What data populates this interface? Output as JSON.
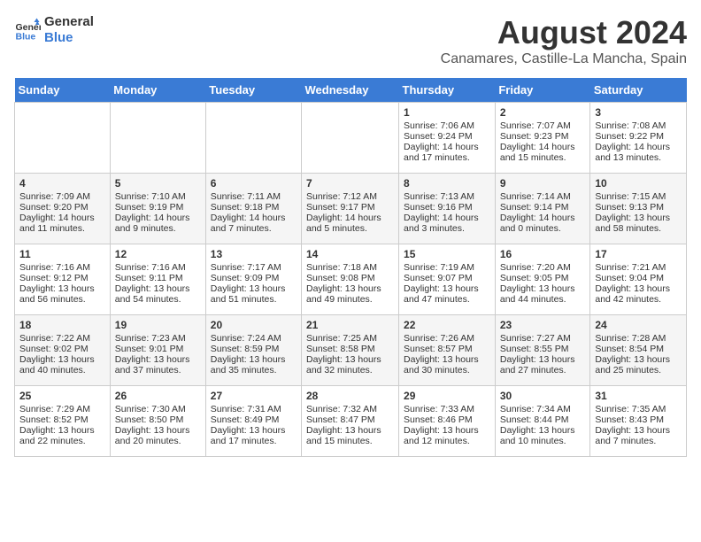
{
  "header": {
    "logo_line1": "General",
    "logo_line2": "Blue",
    "title": "August 2024",
    "subtitle": "Canamares, Castille-La Mancha, Spain"
  },
  "days_of_week": [
    "Sunday",
    "Monday",
    "Tuesday",
    "Wednesday",
    "Thursday",
    "Friday",
    "Saturday"
  ],
  "weeks": [
    [
      {
        "day": "",
        "content": ""
      },
      {
        "day": "",
        "content": ""
      },
      {
        "day": "",
        "content": ""
      },
      {
        "day": "",
        "content": ""
      },
      {
        "day": "1",
        "content": "Sunrise: 7:06 AM\nSunset: 9:24 PM\nDaylight: 14 hours\nand 17 minutes."
      },
      {
        "day": "2",
        "content": "Sunrise: 7:07 AM\nSunset: 9:23 PM\nDaylight: 14 hours\nand 15 minutes."
      },
      {
        "day": "3",
        "content": "Sunrise: 7:08 AM\nSunset: 9:22 PM\nDaylight: 14 hours\nand 13 minutes."
      }
    ],
    [
      {
        "day": "4",
        "content": "Sunrise: 7:09 AM\nSunset: 9:20 PM\nDaylight: 14 hours\nand 11 minutes."
      },
      {
        "day": "5",
        "content": "Sunrise: 7:10 AM\nSunset: 9:19 PM\nDaylight: 14 hours\nand 9 minutes."
      },
      {
        "day": "6",
        "content": "Sunrise: 7:11 AM\nSunset: 9:18 PM\nDaylight: 14 hours\nand 7 minutes."
      },
      {
        "day": "7",
        "content": "Sunrise: 7:12 AM\nSunset: 9:17 PM\nDaylight: 14 hours\nand 5 minutes."
      },
      {
        "day": "8",
        "content": "Sunrise: 7:13 AM\nSunset: 9:16 PM\nDaylight: 14 hours\nand 3 minutes."
      },
      {
        "day": "9",
        "content": "Sunrise: 7:14 AM\nSunset: 9:14 PM\nDaylight: 14 hours\nand 0 minutes."
      },
      {
        "day": "10",
        "content": "Sunrise: 7:15 AM\nSunset: 9:13 PM\nDaylight: 13 hours\nand 58 minutes."
      }
    ],
    [
      {
        "day": "11",
        "content": "Sunrise: 7:16 AM\nSunset: 9:12 PM\nDaylight: 13 hours\nand 56 minutes."
      },
      {
        "day": "12",
        "content": "Sunrise: 7:16 AM\nSunset: 9:11 PM\nDaylight: 13 hours\nand 54 minutes."
      },
      {
        "day": "13",
        "content": "Sunrise: 7:17 AM\nSunset: 9:09 PM\nDaylight: 13 hours\nand 51 minutes."
      },
      {
        "day": "14",
        "content": "Sunrise: 7:18 AM\nSunset: 9:08 PM\nDaylight: 13 hours\nand 49 minutes."
      },
      {
        "day": "15",
        "content": "Sunrise: 7:19 AM\nSunset: 9:07 PM\nDaylight: 13 hours\nand 47 minutes."
      },
      {
        "day": "16",
        "content": "Sunrise: 7:20 AM\nSunset: 9:05 PM\nDaylight: 13 hours\nand 44 minutes."
      },
      {
        "day": "17",
        "content": "Sunrise: 7:21 AM\nSunset: 9:04 PM\nDaylight: 13 hours\nand 42 minutes."
      }
    ],
    [
      {
        "day": "18",
        "content": "Sunrise: 7:22 AM\nSunset: 9:02 PM\nDaylight: 13 hours\nand 40 minutes."
      },
      {
        "day": "19",
        "content": "Sunrise: 7:23 AM\nSunset: 9:01 PM\nDaylight: 13 hours\nand 37 minutes."
      },
      {
        "day": "20",
        "content": "Sunrise: 7:24 AM\nSunset: 8:59 PM\nDaylight: 13 hours\nand 35 minutes."
      },
      {
        "day": "21",
        "content": "Sunrise: 7:25 AM\nSunset: 8:58 PM\nDaylight: 13 hours\nand 32 minutes."
      },
      {
        "day": "22",
        "content": "Sunrise: 7:26 AM\nSunset: 8:57 PM\nDaylight: 13 hours\nand 30 minutes."
      },
      {
        "day": "23",
        "content": "Sunrise: 7:27 AM\nSunset: 8:55 PM\nDaylight: 13 hours\nand 27 minutes."
      },
      {
        "day": "24",
        "content": "Sunrise: 7:28 AM\nSunset: 8:54 PM\nDaylight: 13 hours\nand 25 minutes."
      }
    ],
    [
      {
        "day": "25",
        "content": "Sunrise: 7:29 AM\nSunset: 8:52 PM\nDaylight: 13 hours\nand 22 minutes."
      },
      {
        "day": "26",
        "content": "Sunrise: 7:30 AM\nSunset: 8:50 PM\nDaylight: 13 hours\nand 20 minutes."
      },
      {
        "day": "27",
        "content": "Sunrise: 7:31 AM\nSunset: 8:49 PM\nDaylight: 13 hours\nand 17 minutes."
      },
      {
        "day": "28",
        "content": "Sunrise: 7:32 AM\nSunset: 8:47 PM\nDaylight: 13 hours\nand 15 minutes."
      },
      {
        "day": "29",
        "content": "Sunrise: 7:33 AM\nSunset: 8:46 PM\nDaylight: 13 hours\nand 12 minutes."
      },
      {
        "day": "30",
        "content": "Sunrise: 7:34 AM\nSunset: 8:44 PM\nDaylight: 13 hours\nand 10 minutes."
      },
      {
        "day": "31",
        "content": "Sunrise: 7:35 AM\nSunset: 8:43 PM\nDaylight: 13 hours\nand 7 minutes."
      }
    ]
  ]
}
